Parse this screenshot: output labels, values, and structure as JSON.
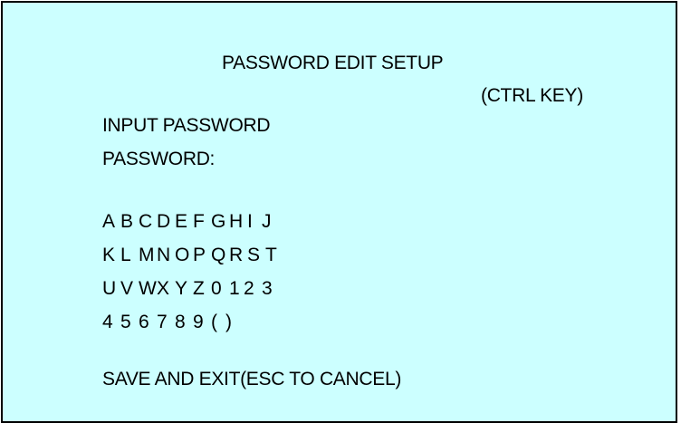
{
  "screen": {
    "title": "PASSWORD EDIT SETUP",
    "ctrl_key": "(CTRL KEY)",
    "input_label": "INPUT PASSWORD",
    "password_label": "PASSWORD:",
    "password_value": "",
    "char_rows": [
      [
        "A",
        "B",
        "C",
        "D",
        "E",
        "F",
        "G",
        "H",
        "I",
        "J"
      ],
      [
        "K",
        "L",
        "M",
        "N",
        "O",
        "P",
        "Q",
        "R",
        "S",
        "T"
      ],
      [
        "U",
        "V",
        "W",
        "X",
        "Y",
        "Z",
        "0",
        "1",
        "2",
        "3"
      ],
      [
        "4",
        "5",
        "6",
        "7",
        "8",
        "9",
        "(",
        ")"
      ]
    ],
    "save_exit": "SAVE AND EXIT(ESC TO CANCEL)"
  },
  "colors": {
    "background": "#ccffff",
    "border": "#000000",
    "text": "#000000"
  }
}
